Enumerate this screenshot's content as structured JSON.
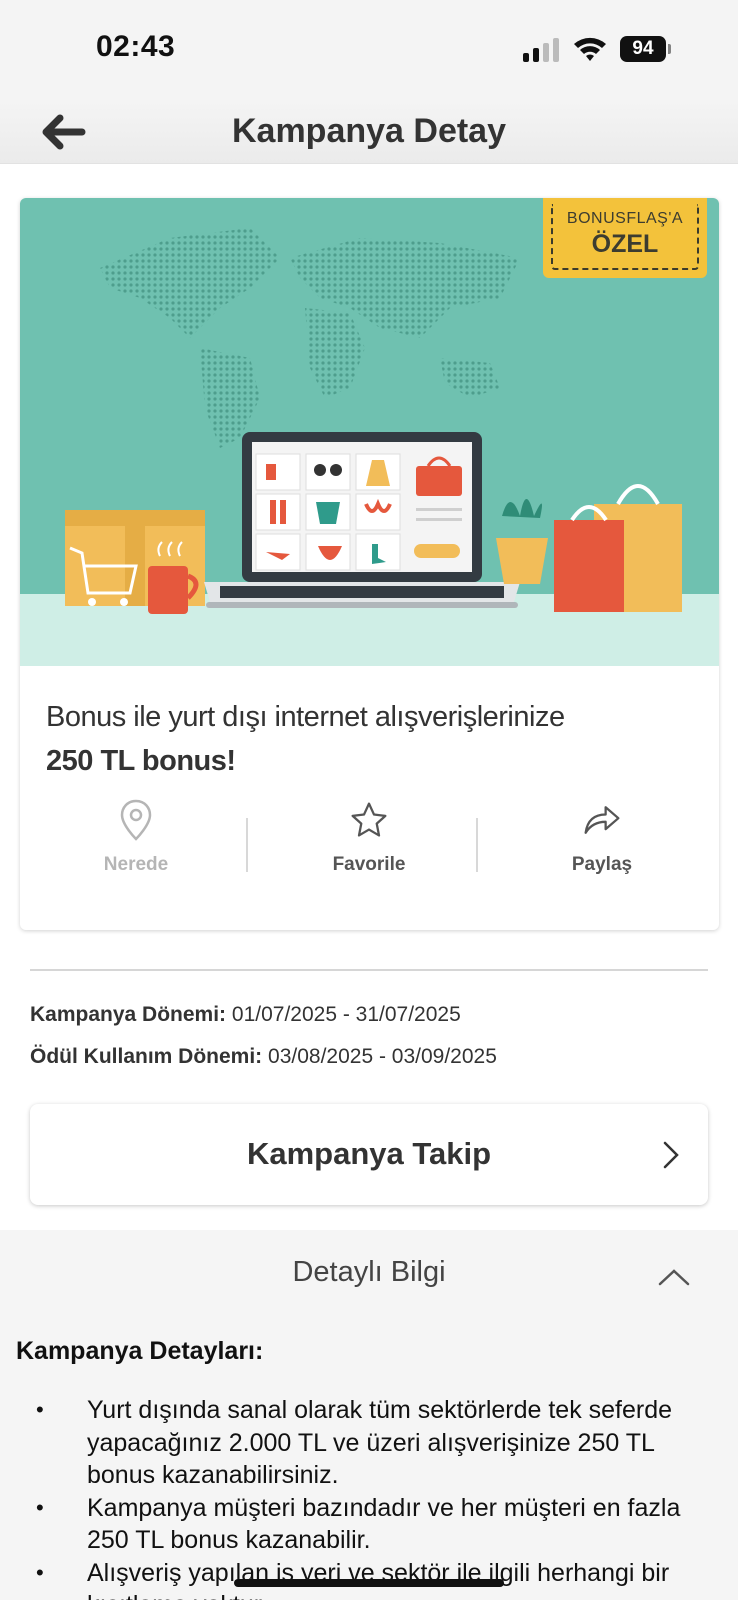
{
  "status_bar": {
    "time": "02:43",
    "battery": "94",
    "icons": [
      "signal-icon",
      "wifi-icon",
      "battery-icon"
    ]
  },
  "nav": {
    "title": "Kampanya Detay",
    "back_icon": "back-arrow-icon"
  },
  "campaign": {
    "badge_top": "BONUSFLAŞ'A",
    "badge_bottom": "ÖZEL",
    "title": "Bonus ile yurt dışı internet alışverişlerinize",
    "bonus": "250 TL bonus!",
    "actions": [
      {
        "label": "Nerede",
        "icon": "location-pin-icon",
        "enabled": false
      },
      {
        "label": "Favorile",
        "icon": "star-icon",
        "enabled": true
      },
      {
        "label": "Paylaş",
        "icon": "share-icon",
        "enabled": true
      }
    ]
  },
  "periods": {
    "campaign_label": "Kampanya Dönemi:",
    "campaign_value": "01/07/2025 - 31/07/2025",
    "reward_label": "Ödül Kullanım Dönemi:",
    "reward_value": "03/08/2025 - 03/09/2025"
  },
  "follow_button": {
    "label": "Kampanya Takip"
  },
  "details": {
    "header": "Detaylı Bilgi",
    "title": "Kampanya Detayları:",
    "items": [
      "Yurt dışında sanal olarak tüm sektörlerde tek seferde yapacağınız  2.000 TL ve üzeri alışverişinize 250 TL bonus kazanabilirsiniz.",
      "Kampanya müşteri bazındadır ve her müşteri en fazla 250 TL bonus kazanabilir.",
      "Alışveriş yapılan iş yeri ve sektör ile ilgili herhangi bir kısıtlama yoktur."
    ]
  },
  "colors": {
    "banner_bg": "#6fc1b0",
    "badge_bg": "#f3c23b",
    "text_dark": "#333333",
    "disabled": "#b5b5b5"
  }
}
